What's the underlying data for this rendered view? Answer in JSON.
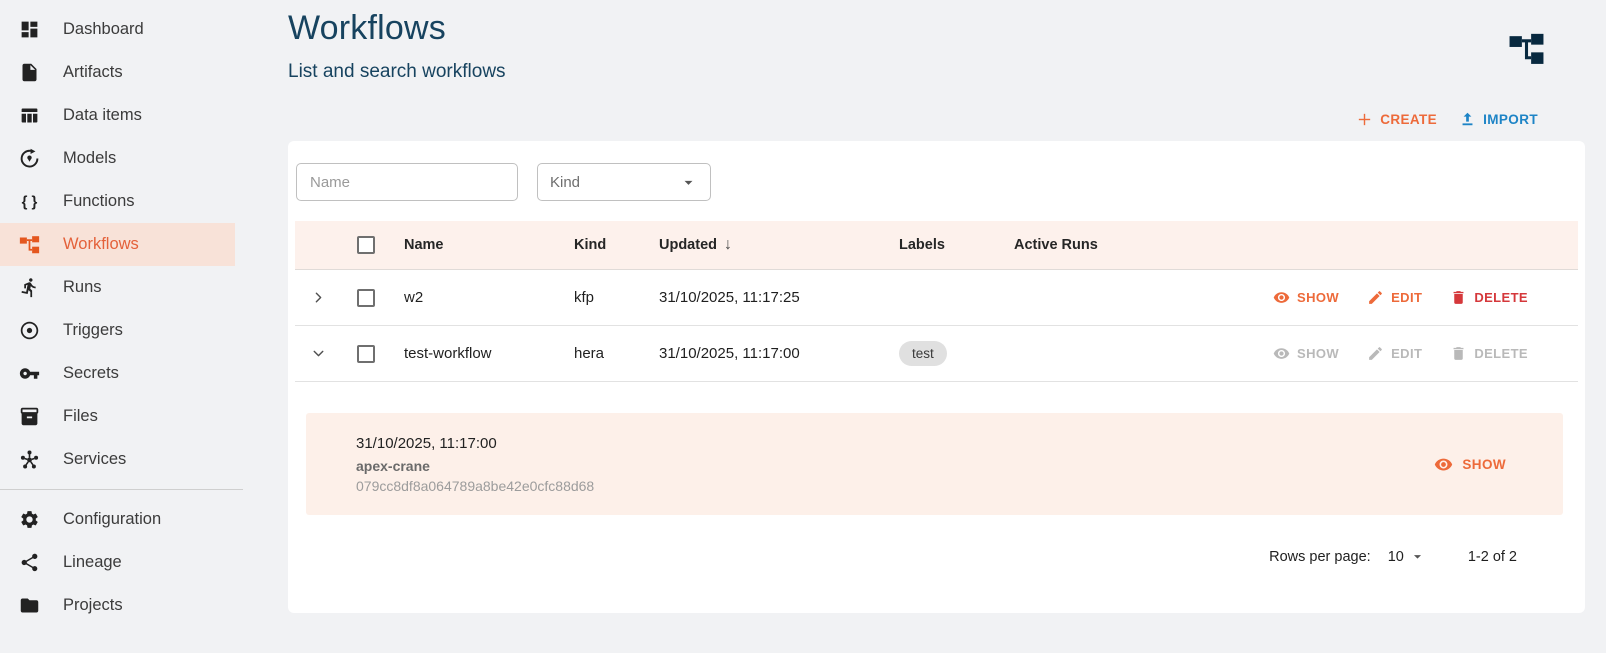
{
  "sidebar": {
    "items": [
      {
        "label": "Dashboard"
      },
      {
        "label": "Artifacts"
      },
      {
        "label": "Data items"
      },
      {
        "label": "Models"
      },
      {
        "label": "Functions"
      },
      {
        "label": "Workflows",
        "selected": true
      },
      {
        "label": "Runs"
      },
      {
        "label": "Triggers"
      },
      {
        "label": "Secrets"
      },
      {
        "label": "Files"
      },
      {
        "label": "Services"
      },
      {
        "label": "Configuration"
      },
      {
        "label": "Lineage"
      },
      {
        "label": "Projects"
      }
    ]
  },
  "header": {
    "title": "Workflows",
    "subtitle": "List and search workflows"
  },
  "toolbar": {
    "create_label": "CREATE",
    "import_label": "IMPORT"
  },
  "filters": {
    "name_placeholder": "Name",
    "kind_label": "Kind"
  },
  "table": {
    "columns": {
      "name": "Name",
      "kind": "Kind",
      "updated": "Updated",
      "labels": "Labels",
      "active_runs": "Active Runs"
    },
    "action_labels": {
      "show": "SHOW",
      "edit": "EDIT",
      "delete": "DELETE"
    },
    "rows": [
      {
        "name": "w2",
        "kind": "kfp",
        "updated": "31/10/2025, 11:17:25"
      },
      {
        "name": "test-workflow",
        "kind": "hera",
        "updated": "31/10/2025, 11:17:00",
        "label": "test"
      }
    ]
  },
  "expanded_run": {
    "timestamp": "31/10/2025, 11:17:00",
    "name": "apex-crane",
    "id": "079cc8df8a064789a8be42e0cfc88d68",
    "show_label": "SHOW"
  },
  "pagination": {
    "rows_per_page_label": "Rows per page:",
    "rows_per_page_value": "10",
    "range_label": "1-2 of 2"
  },
  "colors": {
    "accent_orange": "#ed6a3a",
    "delete_red": "#d5383b",
    "import_blue": "#1d84c6",
    "title_navy": "#17435f",
    "selected_item_bg": "#f8e2d8",
    "table_header_bg": "#fdf1ec",
    "run_panel_bg": "#fdf0e9",
    "page_bg": "#f1f2f4",
    "chip_bg": "#e0e0e0"
  }
}
